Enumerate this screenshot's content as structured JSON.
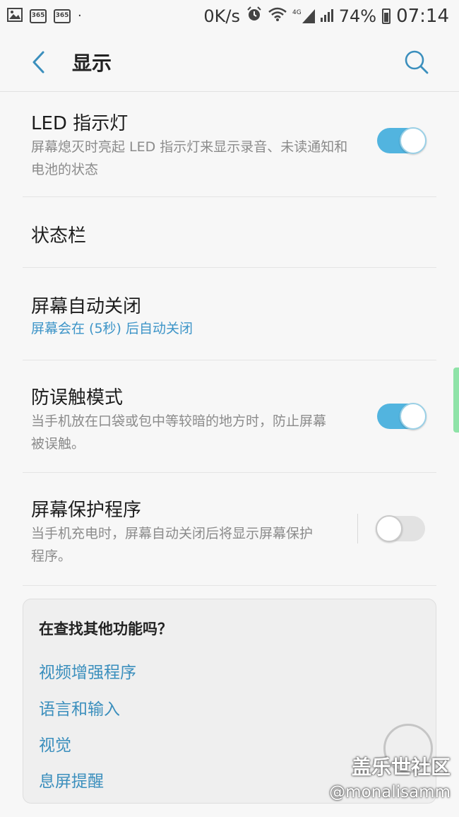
{
  "status_bar": {
    "badge_1": "365",
    "badge_2": "365",
    "dot": "·",
    "network_speed": "0K/s",
    "network_label": "4G",
    "battery": "74%",
    "time": "07:14"
  },
  "header": {
    "title": "显示"
  },
  "settings": [
    {
      "title": "LED 指示灯",
      "desc": "屏幕熄灭时亮起 LED 指示灯来显示录音、未读通知和电池的状态",
      "toggle": "on"
    },
    {
      "title": "状态栏"
    },
    {
      "title": "屏幕自动关闭",
      "desc": "屏幕会在 (5秒) 后自动关闭"
    },
    {
      "title": "防误触模式",
      "desc": "当手机放在口袋或包中等较暗的地方时，防止屏幕被误触。",
      "toggle": "on"
    },
    {
      "title": "屏幕保护程序",
      "desc": "当手机充电时，屏幕自动关闭后将显示屏幕保护程序。",
      "toggle": "off"
    }
  ],
  "suggestions": {
    "title": "在查找其他功能吗？",
    "links": [
      "视频增强程序",
      "语言和输入",
      "视觉",
      "息屏提醒"
    ]
  },
  "watermark": {
    "line1": "盖乐世社区",
    "line2": "@monalisamm"
  },
  "colors": {
    "accent": "#52b4df",
    "link": "#3b8fbd",
    "scroll_indicator": "#8fe3a8"
  }
}
